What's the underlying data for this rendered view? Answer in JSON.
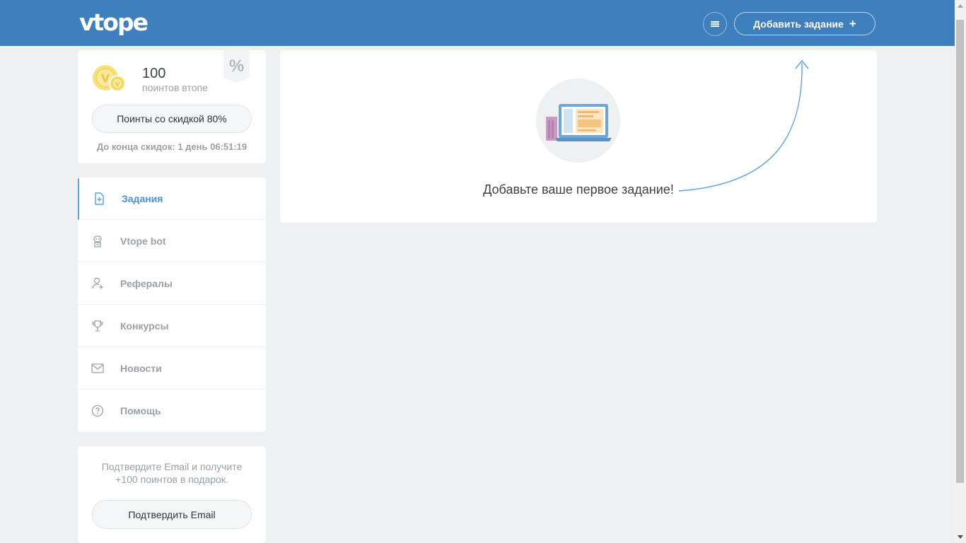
{
  "header": {
    "logo": "vtope",
    "add_task_label": "Добавить задание",
    "add_task_plus": "+"
  },
  "points": {
    "value": "100",
    "label": "поинтов втопе",
    "percent_tag": "%",
    "discount_button": "Поинты со скидкой 80%",
    "countdown": "До конца скидок: 1 день 06:51:19"
  },
  "sidebar": {
    "items": [
      {
        "label": "Задания",
        "icon": "tasks-icon",
        "active": true
      },
      {
        "label": "Vtope bot",
        "icon": "bot-icon",
        "active": false
      },
      {
        "label": "Рефералы",
        "icon": "referrals-icon",
        "active": false
      },
      {
        "label": "Конкурсы",
        "icon": "trophy-icon",
        "active": false
      },
      {
        "label": "Новости",
        "icon": "mail-icon",
        "active": false
      },
      {
        "label": "Помощь",
        "icon": "help-icon",
        "active": false
      }
    ]
  },
  "email": {
    "text_line1": "Подтвердите Email и получите",
    "text_line2": "+100 поинтов в подарок.",
    "button": "Подтвердить Email"
  },
  "main": {
    "empty_title": "Добавьте ваше первое задание!"
  },
  "colors": {
    "header_bg": "#3e7fbd",
    "accent": "#4a92d6",
    "page_bg": "#eff0f2"
  }
}
